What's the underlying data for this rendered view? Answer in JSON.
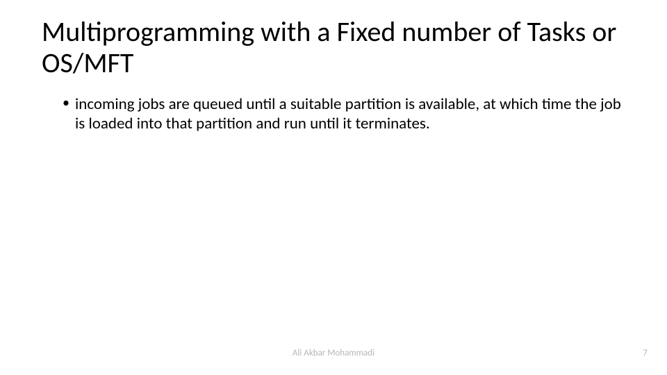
{
  "slide": {
    "title": "Multiprogramming with a Fixed number of Tasks or OS/MFT",
    "bullets": [
      "incoming jobs are queued until a suitable partition is available, at which time the job is loaded into that partition and run until it terminates."
    ],
    "footer_author": "Ali Akbar Mohammadi",
    "page_number": "7"
  }
}
